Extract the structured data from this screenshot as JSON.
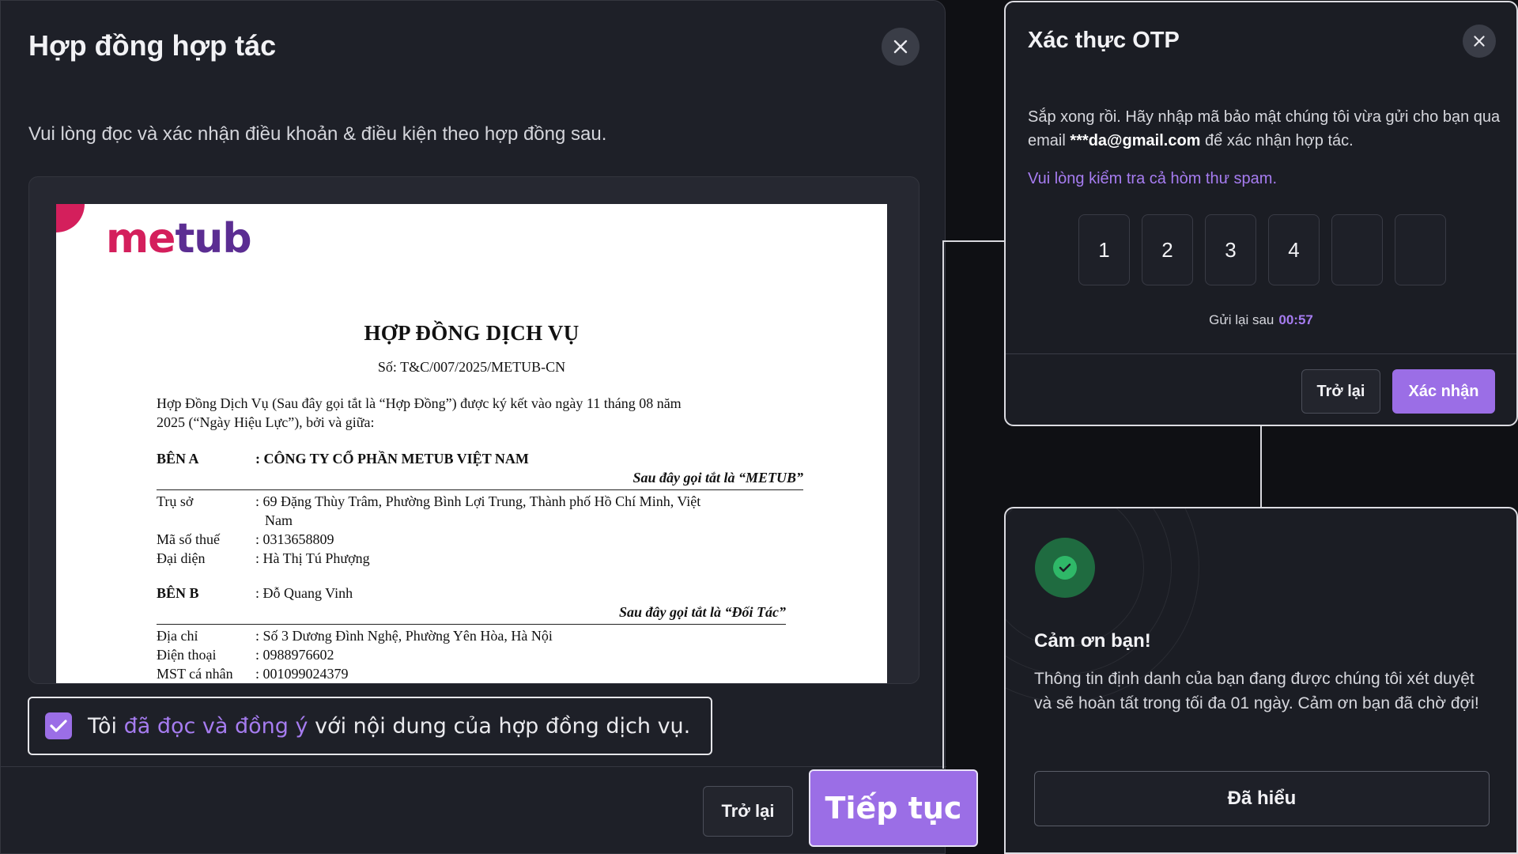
{
  "contract": {
    "title": "Hợp đồng hợp tác",
    "intro": "Vui lòng đọc và xác nhận điều khoản & điều kiện theo hợp đồng sau.",
    "document": {
      "logo_part1": "me",
      "logo_part2": "tub",
      "heading": "HỢP ĐỒNG DỊCH VỤ",
      "number": "Số: T&C/007/2025/METUB-CN",
      "preamble_line1": "Hợp Đồng Dịch Vụ (Sau đây gọi tắt là “Hợp Đồng”) được ký kết vào ngày 11 tháng 08 năm",
      "preamble_line2": "2025 (“Ngày Hiệu Lực”), bởi và giữa:",
      "party_a_label": "BÊN A",
      "party_a_name": ": CÔNG TY CỔ PHẦN METUB VIỆT NAM",
      "party_a_alias": "Sau đây gọi tắt là “METUB”",
      "party_a_fields": [
        {
          "label": "Trụ sở",
          "value": ": 69 Đặng Thùy Trâm, Phường Bình Lợi Trung, Thành phố Hồ Chí Minh, Việt",
          "value2": "Nam"
        },
        {
          "label": "Mã số thuế",
          "value": ": 0313658809"
        },
        {
          "label": "Đại diện",
          "value": ": Hà Thị Tú Phượng"
        }
      ],
      "party_b_label": "BÊN B",
      "party_b_name": ": Đỗ Quang Vinh",
      "party_b_alias": "Sau đây gọi tắt là “Đối Tác”",
      "party_b_fields": [
        {
          "label": "Địa chỉ",
          "value": ": Số 3 Dương Đình Nghệ, Phường Yên Hòa, Hà Nội"
        },
        {
          "label": "Điện thoại",
          "value": ": 0988976602"
        },
        {
          "label": "MST cá nhân",
          "value": ": 001099024379"
        }
      ]
    },
    "agree_prefix": "Tôi ",
    "agree_link": "đã đọc và đồng ý",
    "agree_suffix": " với nội dung của hợp đồng dịch vụ.",
    "agree_checked": true,
    "back_label": "Trở lại",
    "continue_label": "Tiếp tục"
  },
  "otp": {
    "title": "Xác thực OTP",
    "desc_part1": "Sắp xong rồi. Hãy nhập mã bảo mật chúng tôi vừa gửi cho bạn qua email ",
    "email": "***da@gmail.com",
    "desc_part2": " để xác nhận hợp tác.",
    "spam_note": "Vui lòng kiểm tra cả hòm thư spam.",
    "digits": [
      "1",
      "2",
      "3",
      "4",
      "",
      ""
    ],
    "resend_label": "Gửi lại sau",
    "timer": "00:57",
    "back_label": "Trở lại",
    "confirm_label": "Xác nhận"
  },
  "thanks": {
    "title": "Cảm ơn bạn!",
    "body": "Thông tin định danh của bạn đang được chúng tôi xét duyệt và sẽ hoàn tất trong tối đa 01 ngày. Cảm ơn bạn đã chờ đợi!",
    "button_label": "Đã hiểu"
  },
  "colors": {
    "accent": "#9b6ee6",
    "link": "#a67cf0",
    "success": "#2fb868",
    "brand_pink": "#d41f5c",
    "brand_purple": "#5b2d92"
  },
  "icons": {
    "close": "close-icon",
    "check": "checkmark-icon",
    "success": "success-check-icon"
  }
}
